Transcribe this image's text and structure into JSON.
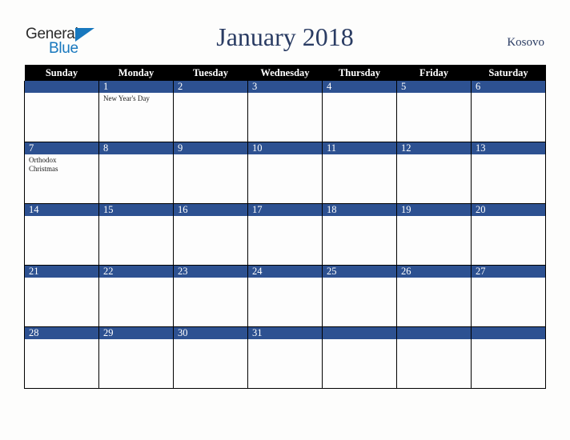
{
  "brand": {
    "name_part1": "General",
    "name_part2": "Blue",
    "triangle_color": "#1878be",
    "text_color": "#2b2b2b"
  },
  "header": {
    "title": "January 2018",
    "region": "Kosovo",
    "title_color": "#2a3c63"
  },
  "calendar": {
    "month": "January",
    "year": "2018",
    "accent_color": "#2d5191",
    "header_bg": "#000000",
    "weekdays": [
      "Sunday",
      "Monday",
      "Tuesday",
      "Wednesday",
      "Thursday",
      "Friday",
      "Saturday"
    ],
    "weeks": [
      [
        {
          "day": "",
          "events": []
        },
        {
          "day": "1",
          "events": [
            "New Year's Day"
          ]
        },
        {
          "day": "2",
          "events": []
        },
        {
          "day": "3",
          "events": []
        },
        {
          "day": "4",
          "events": []
        },
        {
          "day": "5",
          "events": []
        },
        {
          "day": "6",
          "events": []
        }
      ],
      [
        {
          "day": "7",
          "events": [
            "Orthodox",
            "Christmas"
          ]
        },
        {
          "day": "8",
          "events": []
        },
        {
          "day": "9",
          "events": []
        },
        {
          "day": "10",
          "events": []
        },
        {
          "day": "11",
          "events": []
        },
        {
          "day": "12",
          "events": []
        },
        {
          "day": "13",
          "events": []
        }
      ],
      [
        {
          "day": "14",
          "events": []
        },
        {
          "day": "15",
          "events": []
        },
        {
          "day": "16",
          "events": []
        },
        {
          "day": "17",
          "events": []
        },
        {
          "day": "18",
          "events": []
        },
        {
          "day": "19",
          "events": []
        },
        {
          "day": "20",
          "events": []
        }
      ],
      [
        {
          "day": "21",
          "events": []
        },
        {
          "day": "22",
          "events": []
        },
        {
          "day": "23",
          "events": []
        },
        {
          "day": "24",
          "events": []
        },
        {
          "day": "25",
          "events": []
        },
        {
          "day": "26",
          "events": []
        },
        {
          "day": "27",
          "events": []
        }
      ],
      [
        {
          "day": "28",
          "events": []
        },
        {
          "day": "29",
          "events": []
        },
        {
          "day": "30",
          "events": []
        },
        {
          "day": "31",
          "events": []
        },
        {
          "day": "",
          "events": []
        },
        {
          "day": "",
          "events": []
        },
        {
          "day": "",
          "events": []
        }
      ]
    ]
  }
}
